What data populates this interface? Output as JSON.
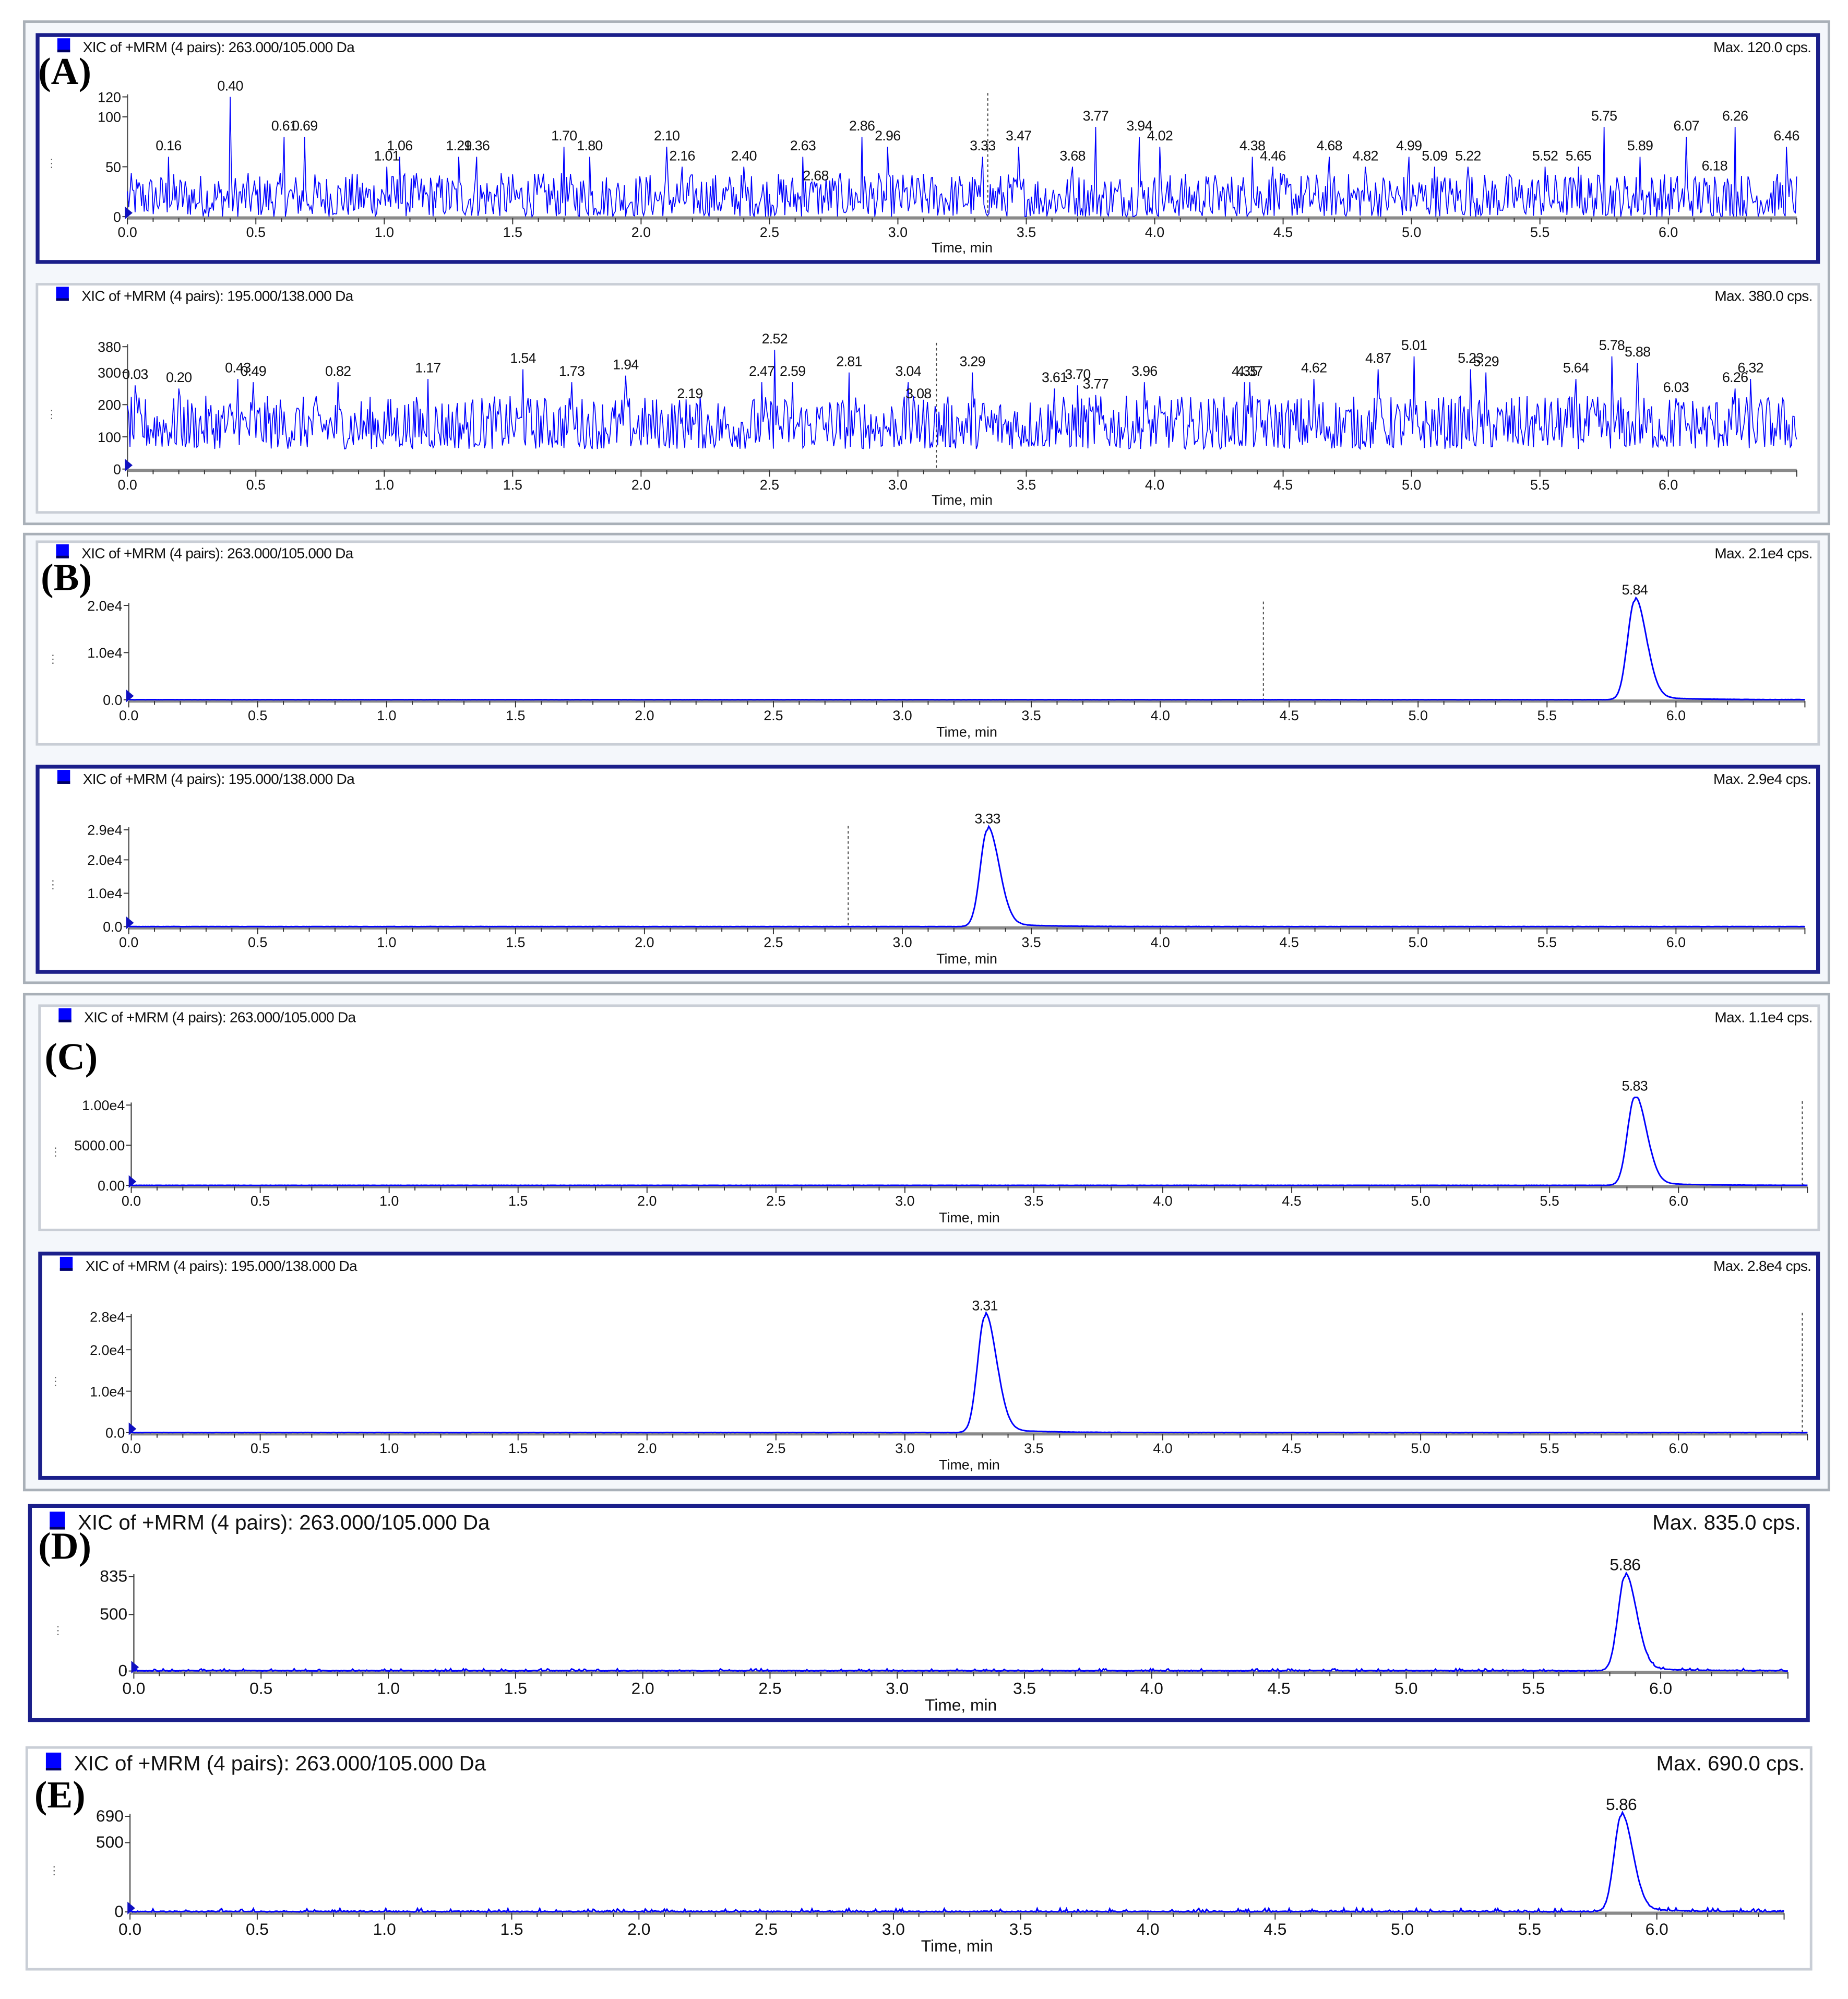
{
  "figure": {
    "panel_labels": [
      "(A)",
      "(B)",
      "(C)",
      "(D)",
      "(E)"
    ]
  },
  "chart_data": [
    {
      "type": "line",
      "title": "XIC of +MRM (4 pairs): 263.000/105.000 Da",
      "max_label": "Max. 120.0 cps.",
      "xlabel": "Time, min",
      "xlim": [
        0,
        6.5
      ],
      "ylim": [
        0,
        120
      ],
      "yticks": [
        "0",
        "50",
        "100",
        "120"
      ],
      "ytick_values": [
        0,
        50,
        100,
        120
      ],
      "xticks": [
        "0.0",
        "0.5",
        "1.0",
        "1.5",
        "2.0",
        "2.5",
        "3.0",
        "3.5",
        "4.0",
        "4.5",
        "5.0",
        "5.5",
        "6.0"
      ],
      "trace": "noise",
      "baseline": 18,
      "noise": 40,
      "cursor_rt": 3.35,
      "peaks": [
        {
          "rt": 0.16,
          "y": 60,
          "label": "0.16"
        },
        {
          "rt": 0.4,
          "y": 120,
          "label": "0.40"
        },
        {
          "rt": 0.61,
          "y": 80,
          "label": "0.61"
        },
        {
          "rt": 0.69,
          "y": 80,
          "label": "0.69"
        },
        {
          "rt": 1.01,
          "y": 50,
          "label": "1.01"
        },
        {
          "rt": 1.06,
          "y": 60,
          "label": "1.06"
        },
        {
          "rt": 1.29,
          "y": 60,
          "label": "1.29"
        },
        {
          "rt": 1.36,
          "y": 60,
          "label": "1.36"
        },
        {
          "rt": 1.7,
          "y": 70,
          "label": "1.70"
        },
        {
          "rt": 1.8,
          "y": 60,
          "label": "1.80"
        },
        {
          "rt": 2.1,
          "y": 70,
          "label": "2.10"
        },
        {
          "rt": 2.16,
          "y": 50,
          "label": "2.16"
        },
        {
          "rt": 2.4,
          "y": 50,
          "label": "2.40"
        },
        {
          "rt": 2.63,
          "y": 60,
          "label": "2.63"
        },
        {
          "rt": 2.68,
          "y": 30,
          "label": "2.68"
        },
        {
          "rt": 2.86,
          "y": 80,
          "label": "2.86"
        },
        {
          "rt": 2.96,
          "y": 70,
          "label": "2.96"
        },
        {
          "rt": 3.33,
          "y": 60,
          "label": "3.33"
        },
        {
          "rt": 3.47,
          "y": 70,
          "label": "3.47"
        },
        {
          "rt": 3.68,
          "y": 50,
          "label": "3.68"
        },
        {
          "rt": 3.77,
          "y": 90,
          "label": "3.77"
        },
        {
          "rt": 3.94,
          "y": 80,
          "label": "3.94"
        },
        {
          "rt": 4.02,
          "y": 70,
          "label": "4.02"
        },
        {
          "rt": 4.38,
          "y": 60,
          "label": "4.38"
        },
        {
          "rt": 4.46,
          "y": 50,
          "label": "4.46"
        },
        {
          "rt": 4.68,
          "y": 60,
          "label": "4.68"
        },
        {
          "rt": 4.82,
          "y": 50,
          "label": "4.82"
        },
        {
          "rt": 4.99,
          "y": 60,
          "label": "4.99"
        },
        {
          "rt": 5.09,
          "y": 50,
          "label": "5.09"
        },
        {
          "rt": 5.22,
          "y": 50,
          "label": "5.22"
        },
        {
          "rt": 5.52,
          "y": 50,
          "label": "5.52"
        },
        {
          "rt": 5.65,
          "y": 50,
          "label": "5.65"
        },
        {
          "rt": 5.75,
          "y": 90,
          "label": "5.75"
        },
        {
          "rt": 5.89,
          "y": 60,
          "label": "5.89"
        },
        {
          "rt": 6.07,
          "y": 80,
          "label": "6.07"
        },
        {
          "rt": 6.18,
          "y": 40,
          "label": "6.18"
        },
        {
          "rt": 6.26,
          "y": 90,
          "label": "6.26"
        },
        {
          "rt": 6.46,
          "y": 70,
          "label": "6.46"
        }
      ]
    },
    {
      "type": "line",
      "title": "XIC of +MRM (4 pairs): 195.000/138.000 Da",
      "max_label": "Max. 380.0 cps.",
      "xlabel": "Time, min",
      "xlim": [
        0,
        6.5
      ],
      "ylim": [
        0,
        380
      ],
      "yticks": [
        "0",
        "100",
        "200",
        "300",
        "380"
      ],
      "ytick_values": [
        0,
        100,
        200,
        300,
        380
      ],
      "xticks": [
        "0.0",
        "0.5",
        "1.0",
        "1.5",
        "2.0",
        "2.5",
        "3.0",
        "3.5",
        "4.0",
        "4.5",
        "5.0",
        "5.5",
        "6.0"
      ],
      "trace": "noise",
      "baseline": 130,
      "noise": 150,
      "cursor_rt": 3.15,
      "peaks": [
        {
          "rt": 0.03,
          "y": 260,
          "label": "0.03"
        },
        {
          "rt": 0.2,
          "y": 250,
          "label": "0.20"
        },
        {
          "rt": 0.43,
          "y": 280,
          "label": "0.43"
        },
        {
          "rt": 0.49,
          "y": 270,
          "label": "0.49"
        },
        {
          "rt": 0.82,
          "y": 270,
          "label": "0.82"
        },
        {
          "rt": 1.17,
          "y": 280,
          "label": "1.17"
        },
        {
          "rt": 1.54,
          "y": 310,
          "label": "1.54"
        },
        {
          "rt": 1.73,
          "y": 270,
          "label": "1.73"
        },
        {
          "rt": 1.94,
          "y": 290,
          "label": "1.94"
        },
        {
          "rt": 2.19,
          "y": 200,
          "label": "2.19"
        },
        {
          "rt": 2.47,
          "y": 270,
          "label": "2.47"
        },
        {
          "rt": 2.52,
          "y": 370,
          "label": "2.52"
        },
        {
          "rt": 2.59,
          "y": 270,
          "label": "2.59"
        },
        {
          "rt": 2.81,
          "y": 300,
          "label": "2.81"
        },
        {
          "rt": 3.04,
          "y": 270,
          "label": "3.04"
        },
        {
          "rt": 3.08,
          "y": 200,
          "label": "3.08"
        },
        {
          "rt": 3.29,
          "y": 300,
          "label": "3.29"
        },
        {
          "rt": 3.61,
          "y": 250,
          "label": "3.61"
        },
        {
          "rt": 3.7,
          "y": 260,
          "label": "3.70"
        },
        {
          "rt": 3.77,
          "y": 230,
          "label": "3.77"
        },
        {
          "rt": 3.96,
          "y": 270,
          "label": "3.96"
        },
        {
          "rt": 4.35,
          "y": 270,
          "label": "4.35"
        },
        {
          "rt": 4.37,
          "y": 270,
          "label": "4.37"
        },
        {
          "rt": 4.62,
          "y": 280,
          "label": "4.62"
        },
        {
          "rt": 4.87,
          "y": 310,
          "label": "4.87"
        },
        {
          "rt": 5.01,
          "y": 350,
          "label": "5.01"
        },
        {
          "rt": 5.23,
          "y": 310,
          "label": "5.23"
        },
        {
          "rt": 5.29,
          "y": 300,
          "label": "5.29"
        },
        {
          "rt": 5.64,
          "y": 280,
          "label": "5.64"
        },
        {
          "rt": 5.78,
          "y": 350,
          "label": "5.78"
        },
        {
          "rt": 5.88,
          "y": 330,
          "label": "5.88"
        },
        {
          "rt": 6.03,
          "y": 220,
          "label": "6.03"
        },
        {
          "rt": 6.26,
          "y": 250,
          "label": "6.26"
        },
        {
          "rt": 6.32,
          "y": 280,
          "label": "6.32"
        }
      ]
    },
    {
      "type": "line",
      "title": "XIC of +MRM (4 pairs): 263.000/105.000 Da",
      "max_label": "Max. 2.1e4 cps.",
      "xlabel": "Time, min",
      "xlim": [
        0,
        6.5
      ],
      "ylim": [
        0,
        20000
      ],
      "yticks": [
        "0.0",
        "1.0e4",
        "2.0e4"
      ],
      "ytick_values": [
        0,
        10000,
        20000
      ],
      "xticks": [
        "0.0",
        "0.5",
        "1.0",
        "1.5",
        "2.0",
        "2.5",
        "3.0",
        "3.5",
        "4.0",
        "4.5",
        "5.0",
        "5.5",
        "6.0"
      ],
      "trace": "peak",
      "cursor_rt": 4.4,
      "peaks": [
        {
          "rt": 5.84,
          "y": 21000,
          "label": "5.84"
        }
      ]
    },
    {
      "type": "line",
      "title": "XIC of +MRM (4 pairs): 195.000/138.000 Da",
      "max_label": "Max. 2.9e4 cps.",
      "xlabel": "Time, min",
      "xlim": [
        0,
        6.5
      ],
      "ylim": [
        0,
        29000
      ],
      "yticks": [
        "0.0",
        "1.0e4",
        "2.0e4",
        "2.9e4"
      ],
      "ytick_values": [
        0,
        10000,
        20000,
        29000
      ],
      "xticks": [
        "0.0",
        "0.5",
        "1.0",
        "1.5",
        "2.0",
        "2.5",
        "3.0",
        "3.5",
        "4.0",
        "4.5",
        "5.0",
        "5.5",
        "6.0"
      ],
      "trace": "peak",
      "cursor_rt": 2.79,
      "peaks": [
        {
          "rt": 3.33,
          "y": 29000,
          "label": "3.33"
        }
      ]
    },
    {
      "type": "line",
      "title": "XIC of +MRM (4 pairs): 263.000/105.000 Da",
      "max_label": "Max. 1.1e4 cps.",
      "xlabel": "Time, min",
      "xlim": [
        0,
        6.5
      ],
      "ylim": [
        0,
        10000
      ],
      "yticks": [
        "0.00",
        "5000.00",
        "1.00e4"
      ],
      "ytick_values": [
        0,
        5000,
        10000
      ],
      "xticks": [
        "0.0",
        "0.5",
        "1.0",
        "1.5",
        "2.0",
        "2.5",
        "3.0",
        "3.5",
        "4.0",
        "4.5",
        "5.0",
        "5.5",
        "6.0"
      ],
      "trace": "peak",
      "cursor_rt": 6.48,
      "peaks": [
        {
          "rt": 5.83,
          "y": 11000,
          "label": "5.83"
        }
      ]
    },
    {
      "type": "line",
      "title": "XIC of +MRM (4 pairs): 195.000/138.000 Da",
      "max_label": "Max. 2.8e4 cps.",
      "xlabel": "Time, min",
      "xlim": [
        0,
        6.5
      ],
      "ylim": [
        0,
        28000
      ],
      "yticks": [
        "0.0",
        "1.0e4",
        "2.0e4",
        "2.8e4"
      ],
      "ytick_values": [
        0,
        10000,
        20000,
        28000
      ],
      "xticks": [
        "0.0",
        "0.5",
        "1.0",
        "1.5",
        "2.0",
        "2.5",
        "3.0",
        "3.5",
        "4.0",
        "4.5",
        "5.0",
        "5.5",
        "6.0"
      ],
      "trace": "peak",
      "cursor_rt": 6.48,
      "peaks": [
        {
          "rt": 3.31,
          "y": 28000,
          "label": "3.31"
        }
      ]
    },
    {
      "type": "line",
      "title": "XIC of +MRM (4 pairs): 263.000/105.000 Da",
      "max_label": "Max. 835.0 cps.",
      "xlabel": "Time, min",
      "xlim": [
        0,
        6.5
      ],
      "ylim": [
        0,
        835
      ],
      "yticks": [
        "0",
        "500",
        "835"
      ],
      "ytick_values": [
        0,
        500,
        835
      ],
      "xticks": [
        "0.0",
        "0.5",
        "1.0",
        "1.5",
        "2.0",
        "2.5",
        "3.0",
        "3.5",
        "4.0",
        "4.5",
        "5.0",
        "5.5",
        "6.0"
      ],
      "trace": "peak",
      "baseline_noise": 20,
      "peaks": [
        {
          "rt": 5.86,
          "y": 835,
          "label": "5.86"
        }
      ]
    },
    {
      "type": "line",
      "title": "XIC of +MRM (4 pairs): 263.000/105.000 Da",
      "max_label": "Max. 690.0 cps.",
      "xlabel": "Time, min",
      "xlim": [
        0,
        6.5
      ],
      "ylim": [
        0,
        690
      ],
      "yticks": [
        "0",
        "500",
        "690"
      ],
      "ytick_values": [
        0,
        500,
        690
      ],
      "xticks": [
        "0.0",
        "0.5",
        "1.0",
        "1.5",
        "2.0",
        "2.5",
        "3.0",
        "3.5",
        "4.0",
        "4.5",
        "5.0",
        "5.5",
        "6.0"
      ],
      "trace": "peak",
      "baseline_noise": 25,
      "peaks": [
        {
          "rt": 5.86,
          "y": 690,
          "label": "5.86"
        }
      ]
    }
  ]
}
